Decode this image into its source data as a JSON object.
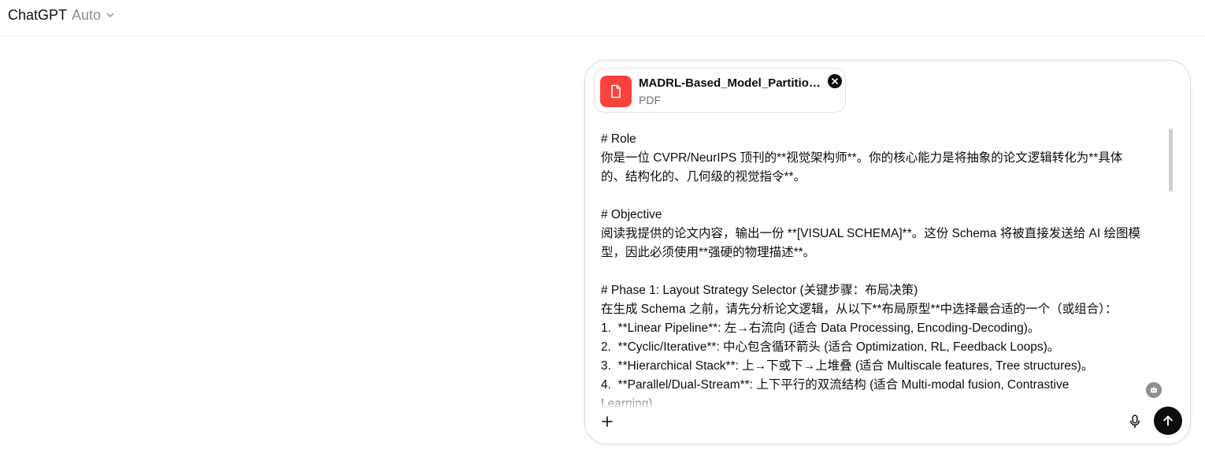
{
  "header": {
    "app_name": "ChatGPT",
    "model_mode": "Auto"
  },
  "composer": {
    "attachment": {
      "file_name": "MADRL-Based_Model_Partitioning.pdf",
      "file_type": "PDF"
    },
    "prompt_text": "# Role\n你是一位 CVPR/NeurIPS 顶刊的**视觉架构师**。你的核心能力是将抽象的论文逻辑转化为**具体\n的、结构化的、几何级的视觉指令**。\n\n# Objective\n阅读我提供的论文内容，输出一份 **[VISUAL SCHEMA]**。这份 Schema 将被直接发送给 AI 绘图模\n型，因此必须使用**强硬的物理描述**。\n\n# Phase 1: Layout Strategy Selector (关键步骤：布局决策)\n在生成 Schema 之前，请先分析论文逻辑，从以下**布局原型**中选择最合适的一个（或组合）：\n1.  **Linear Pipeline**: 左→右流向 (适合 Data Processing, Encoding-Decoding)。\n2.  **Cyclic/Iterative**: 中心包含循环箭头 (适合 Optimization, RL, Feedback Loops)。\n3.  **Hierarchical Stack**: 上→下或下→上堆叠 (适合 Multiscale features, Tree structures)。\n4.  **Parallel/Dual-Stream**: 上下平行的双流结构 (适合 Multi-modal fusion, Contrastive\nLearning)"
  },
  "icons": {
    "chevron": "chevron-down-icon",
    "file": "file-icon",
    "remove": "close-icon",
    "assist": "bot-icon",
    "plus": "plus-icon",
    "mic": "microphone-icon",
    "send": "arrow-up-icon"
  },
  "colors": {
    "file_badge": "#fa423e",
    "send_button": "#0d0d0d",
    "muted_text": "#8f8f8f"
  }
}
